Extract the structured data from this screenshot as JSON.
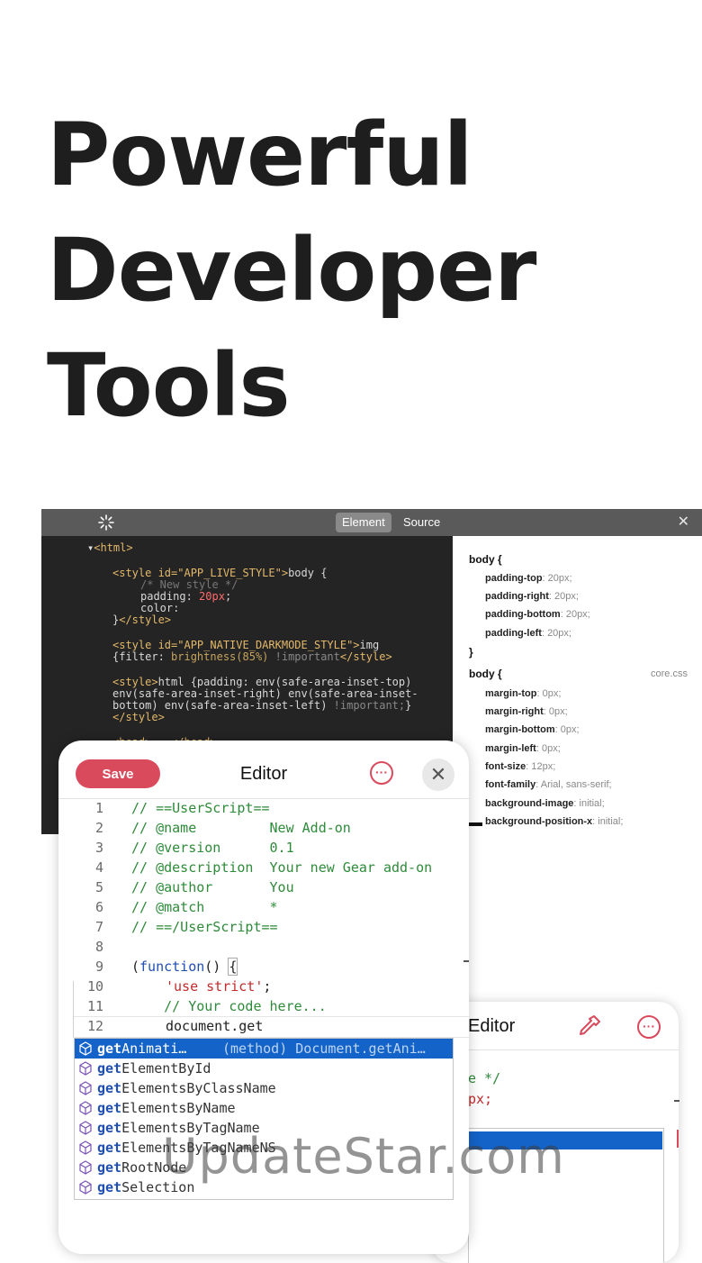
{
  "headline": [
    "Powerful",
    "Developer",
    "Tools"
  ],
  "inspector": {
    "tabs": [
      "Element",
      "Source"
    ],
    "active_tab": "Element",
    "left_icon": "loading-spinner-icon",
    "close_icon": "close-icon",
    "dom": {
      "l1": "<html>",
      "l2_tag": "<style id=\"APP_LIVE_STYLE\">",
      "l2_text": "body {",
      "l3": "/* New style */",
      "l4_prop": "padding: ",
      "l4_val": "20px",
      "l4_end": ";",
      "l5": "color:",
      "l6_text": "}",
      "l6_tag": "</style>",
      "l7_tag": "<style id=\"APP_NATIVE_DARKMODE_STYLE\">",
      "l7_text": "img",
      "l8_a": "{filter: ",
      "l8_fn": "brightness(85%)",
      "l8_imp": " !important",
      "l8_tag": "</style>",
      "l9_tag": "<style>",
      "l9_text": "html {padding: env(safe-area-inset-top)",
      "l10": "env(safe-area-inset-right) env(safe-area-inset-",
      "l11_a": "bottom) env(safe-area-inset-left)",
      "l11_imp": " !important;",
      "l11_b": "}",
      "l12": "</style>",
      "l13": "<head>...</head>"
    },
    "css": {
      "rule1_selector": "body {",
      "rule1_props": [
        {
          "name": "padding-top",
          "value": "20px;"
        },
        {
          "name": "padding-right",
          "value": "20px;"
        },
        {
          "name": "padding-bottom",
          "value": "20px;"
        },
        {
          "name": "padding-left",
          "value": "20px;"
        }
      ],
      "rule1_close": "}",
      "rule2_selector": "body {",
      "rule2_source": "core.css",
      "rule2_props": [
        {
          "name": "margin-top",
          "value": "0px;"
        },
        {
          "name": "margin-right",
          "value": "0px;"
        },
        {
          "name": "margin-bottom",
          "value": "0px;"
        },
        {
          "name": "margin-left",
          "value": "0px;"
        },
        {
          "name": "font-size",
          "value": "12px;"
        },
        {
          "name": "font-family",
          "value": "Arial, sans-serif;"
        },
        {
          "name": "background-image",
          "value": "initial;"
        },
        {
          "name": "background-position-x",
          "value": "initial;"
        }
      ]
    }
  },
  "editor": {
    "save_label": "Save",
    "title": "Editor",
    "lines": [
      {
        "n": "1",
        "text": "// ==UserScript=="
      },
      {
        "n": "2",
        "text": "// @name         New Add-on"
      },
      {
        "n": "3",
        "text": "// @version      0.1"
      },
      {
        "n": "4",
        "text": "// @description  Your new Gear add-on"
      },
      {
        "n": "5",
        "text": "// @author       You"
      },
      {
        "n": "6",
        "text": "// @match        *"
      },
      {
        "n": "7",
        "text": "// ==/UserScript=="
      },
      {
        "n": "8",
        "text": ""
      },
      {
        "n": "9",
        "text": ""
      },
      {
        "n": "10",
        "text": ""
      },
      {
        "n": "11",
        "text": "    // Your code here..."
      },
      {
        "n": "12",
        "text": ""
      }
    ],
    "line9": {
      "open": "(",
      "kw": "function",
      "mid": "() ",
      "brace": "{"
    },
    "line10": {
      "str": "'use strict'",
      "end": ";"
    },
    "line12": {
      "text": "document.get"
    },
    "autocomplete": [
      {
        "prefix": "get",
        "rest": "Animati…",
        "detail": "(method) Document.getAni…"
      },
      {
        "prefix": "get",
        "rest": "ElementById"
      },
      {
        "prefix": "get",
        "rest": "ElementsByClassName"
      },
      {
        "prefix": "get",
        "rest": "ElementsByName"
      },
      {
        "prefix": "get",
        "rest": "ElementsByTagName"
      },
      {
        "prefix": "get",
        "rest": "ElementsByTagNameNS"
      },
      {
        "prefix": "get",
        "rest": "RootNode"
      },
      {
        "prefix": "get",
        "rest": "Selection"
      }
    ]
  },
  "editor2": {
    "title": "Editor",
    "line1": "e */",
    "line2": "px;"
  },
  "watermark": "UpdateStar.com",
  "colors": {
    "accent": "#d94a5c",
    "selection": "#1463c8",
    "comment": "#2e8b3a"
  }
}
